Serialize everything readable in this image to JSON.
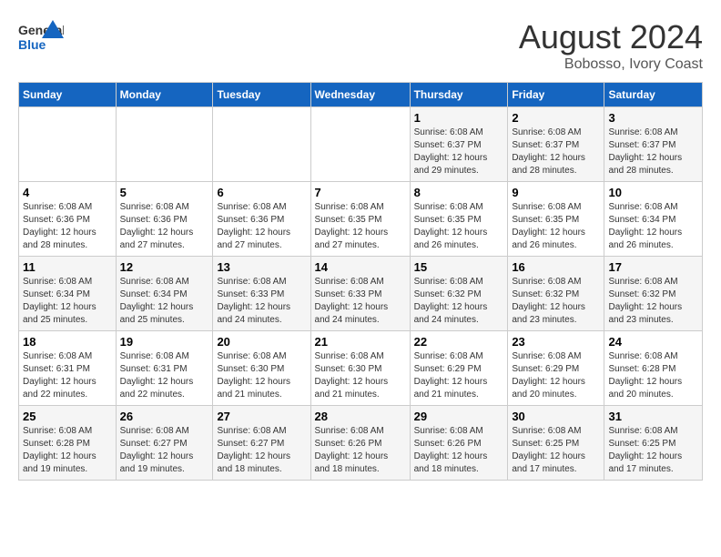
{
  "header": {
    "logo_general": "General",
    "logo_blue": "Blue",
    "month_year": "August 2024",
    "location": "Bobosso, Ivory Coast"
  },
  "days_of_week": [
    "Sunday",
    "Monday",
    "Tuesday",
    "Wednesday",
    "Thursday",
    "Friday",
    "Saturday"
  ],
  "weeks": [
    {
      "days": [
        {
          "number": "",
          "info": ""
        },
        {
          "number": "",
          "info": ""
        },
        {
          "number": "",
          "info": ""
        },
        {
          "number": "",
          "info": ""
        },
        {
          "number": "1",
          "info": "Sunrise: 6:08 AM\nSunset: 6:37 PM\nDaylight: 12 hours\nand 29 minutes."
        },
        {
          "number": "2",
          "info": "Sunrise: 6:08 AM\nSunset: 6:37 PM\nDaylight: 12 hours\nand 28 minutes."
        },
        {
          "number": "3",
          "info": "Sunrise: 6:08 AM\nSunset: 6:37 PM\nDaylight: 12 hours\nand 28 minutes."
        }
      ]
    },
    {
      "days": [
        {
          "number": "4",
          "info": "Sunrise: 6:08 AM\nSunset: 6:36 PM\nDaylight: 12 hours\nand 28 minutes."
        },
        {
          "number": "5",
          "info": "Sunrise: 6:08 AM\nSunset: 6:36 PM\nDaylight: 12 hours\nand 27 minutes."
        },
        {
          "number": "6",
          "info": "Sunrise: 6:08 AM\nSunset: 6:36 PM\nDaylight: 12 hours\nand 27 minutes."
        },
        {
          "number": "7",
          "info": "Sunrise: 6:08 AM\nSunset: 6:35 PM\nDaylight: 12 hours\nand 27 minutes."
        },
        {
          "number": "8",
          "info": "Sunrise: 6:08 AM\nSunset: 6:35 PM\nDaylight: 12 hours\nand 26 minutes."
        },
        {
          "number": "9",
          "info": "Sunrise: 6:08 AM\nSunset: 6:35 PM\nDaylight: 12 hours\nand 26 minutes."
        },
        {
          "number": "10",
          "info": "Sunrise: 6:08 AM\nSunset: 6:34 PM\nDaylight: 12 hours\nand 26 minutes."
        }
      ]
    },
    {
      "days": [
        {
          "number": "11",
          "info": "Sunrise: 6:08 AM\nSunset: 6:34 PM\nDaylight: 12 hours\nand 25 minutes."
        },
        {
          "number": "12",
          "info": "Sunrise: 6:08 AM\nSunset: 6:34 PM\nDaylight: 12 hours\nand 25 minutes."
        },
        {
          "number": "13",
          "info": "Sunrise: 6:08 AM\nSunset: 6:33 PM\nDaylight: 12 hours\nand 24 minutes."
        },
        {
          "number": "14",
          "info": "Sunrise: 6:08 AM\nSunset: 6:33 PM\nDaylight: 12 hours\nand 24 minutes."
        },
        {
          "number": "15",
          "info": "Sunrise: 6:08 AM\nSunset: 6:32 PM\nDaylight: 12 hours\nand 24 minutes."
        },
        {
          "number": "16",
          "info": "Sunrise: 6:08 AM\nSunset: 6:32 PM\nDaylight: 12 hours\nand 23 minutes."
        },
        {
          "number": "17",
          "info": "Sunrise: 6:08 AM\nSunset: 6:32 PM\nDaylight: 12 hours\nand 23 minutes."
        }
      ]
    },
    {
      "days": [
        {
          "number": "18",
          "info": "Sunrise: 6:08 AM\nSunset: 6:31 PM\nDaylight: 12 hours\nand 22 minutes."
        },
        {
          "number": "19",
          "info": "Sunrise: 6:08 AM\nSunset: 6:31 PM\nDaylight: 12 hours\nand 22 minutes."
        },
        {
          "number": "20",
          "info": "Sunrise: 6:08 AM\nSunset: 6:30 PM\nDaylight: 12 hours\nand 21 minutes."
        },
        {
          "number": "21",
          "info": "Sunrise: 6:08 AM\nSunset: 6:30 PM\nDaylight: 12 hours\nand 21 minutes."
        },
        {
          "number": "22",
          "info": "Sunrise: 6:08 AM\nSunset: 6:29 PM\nDaylight: 12 hours\nand 21 minutes."
        },
        {
          "number": "23",
          "info": "Sunrise: 6:08 AM\nSunset: 6:29 PM\nDaylight: 12 hours\nand 20 minutes."
        },
        {
          "number": "24",
          "info": "Sunrise: 6:08 AM\nSunset: 6:28 PM\nDaylight: 12 hours\nand 20 minutes."
        }
      ]
    },
    {
      "days": [
        {
          "number": "25",
          "info": "Sunrise: 6:08 AM\nSunset: 6:28 PM\nDaylight: 12 hours\nand 19 minutes."
        },
        {
          "number": "26",
          "info": "Sunrise: 6:08 AM\nSunset: 6:27 PM\nDaylight: 12 hours\nand 19 minutes."
        },
        {
          "number": "27",
          "info": "Sunrise: 6:08 AM\nSunset: 6:27 PM\nDaylight: 12 hours\nand 18 minutes."
        },
        {
          "number": "28",
          "info": "Sunrise: 6:08 AM\nSunset: 6:26 PM\nDaylight: 12 hours\nand 18 minutes."
        },
        {
          "number": "29",
          "info": "Sunrise: 6:08 AM\nSunset: 6:26 PM\nDaylight: 12 hours\nand 18 minutes."
        },
        {
          "number": "30",
          "info": "Sunrise: 6:08 AM\nSunset: 6:25 PM\nDaylight: 12 hours\nand 17 minutes."
        },
        {
          "number": "31",
          "info": "Sunrise: 6:08 AM\nSunset: 6:25 PM\nDaylight: 12 hours\nand 17 minutes."
        }
      ]
    }
  ]
}
